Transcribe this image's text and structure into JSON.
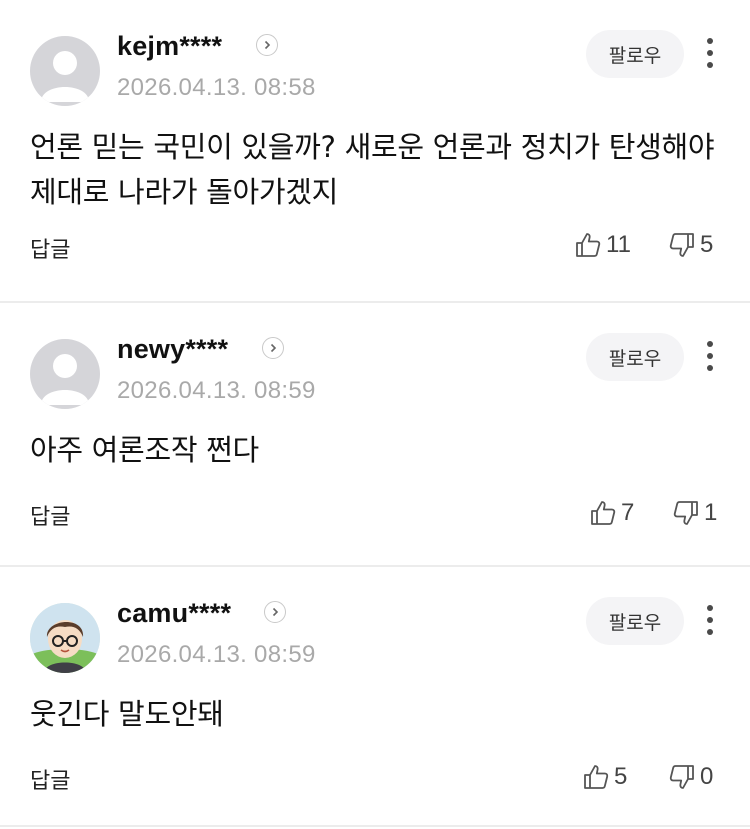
{
  "follow_label": "팔로우",
  "reply_label": "답글",
  "comments": [
    {
      "nickname": "kejm****",
      "date": "2026.04.13. 08:58",
      "text": "언론 믿는 국민이 있을까? 새로운 언론과 정치가 탄생해야 제대로 나라가 돌아가겠지",
      "likes": "11",
      "dislikes": "5",
      "avatar": "default-avatar-icon"
    },
    {
      "nickname": "newy****",
      "date": "2026.04.13. 08:59",
      "text": "아주 여론조작 쩐다",
      "likes": "7",
      "dislikes": "1",
      "avatar": "default-avatar-icon"
    },
    {
      "nickname": "camu****",
      "date": "2026.04.13. 08:59",
      "text": "웃긴다 말도안돼",
      "likes": "5",
      "dislikes": "0",
      "avatar": "character-avatar-glasses"
    }
  ],
  "colors": {
    "divider": "#ececec",
    "date": "#a9a9a9",
    "follow_bg": "#f4f4f6",
    "avatar_bg": "#d5d5d9"
  }
}
